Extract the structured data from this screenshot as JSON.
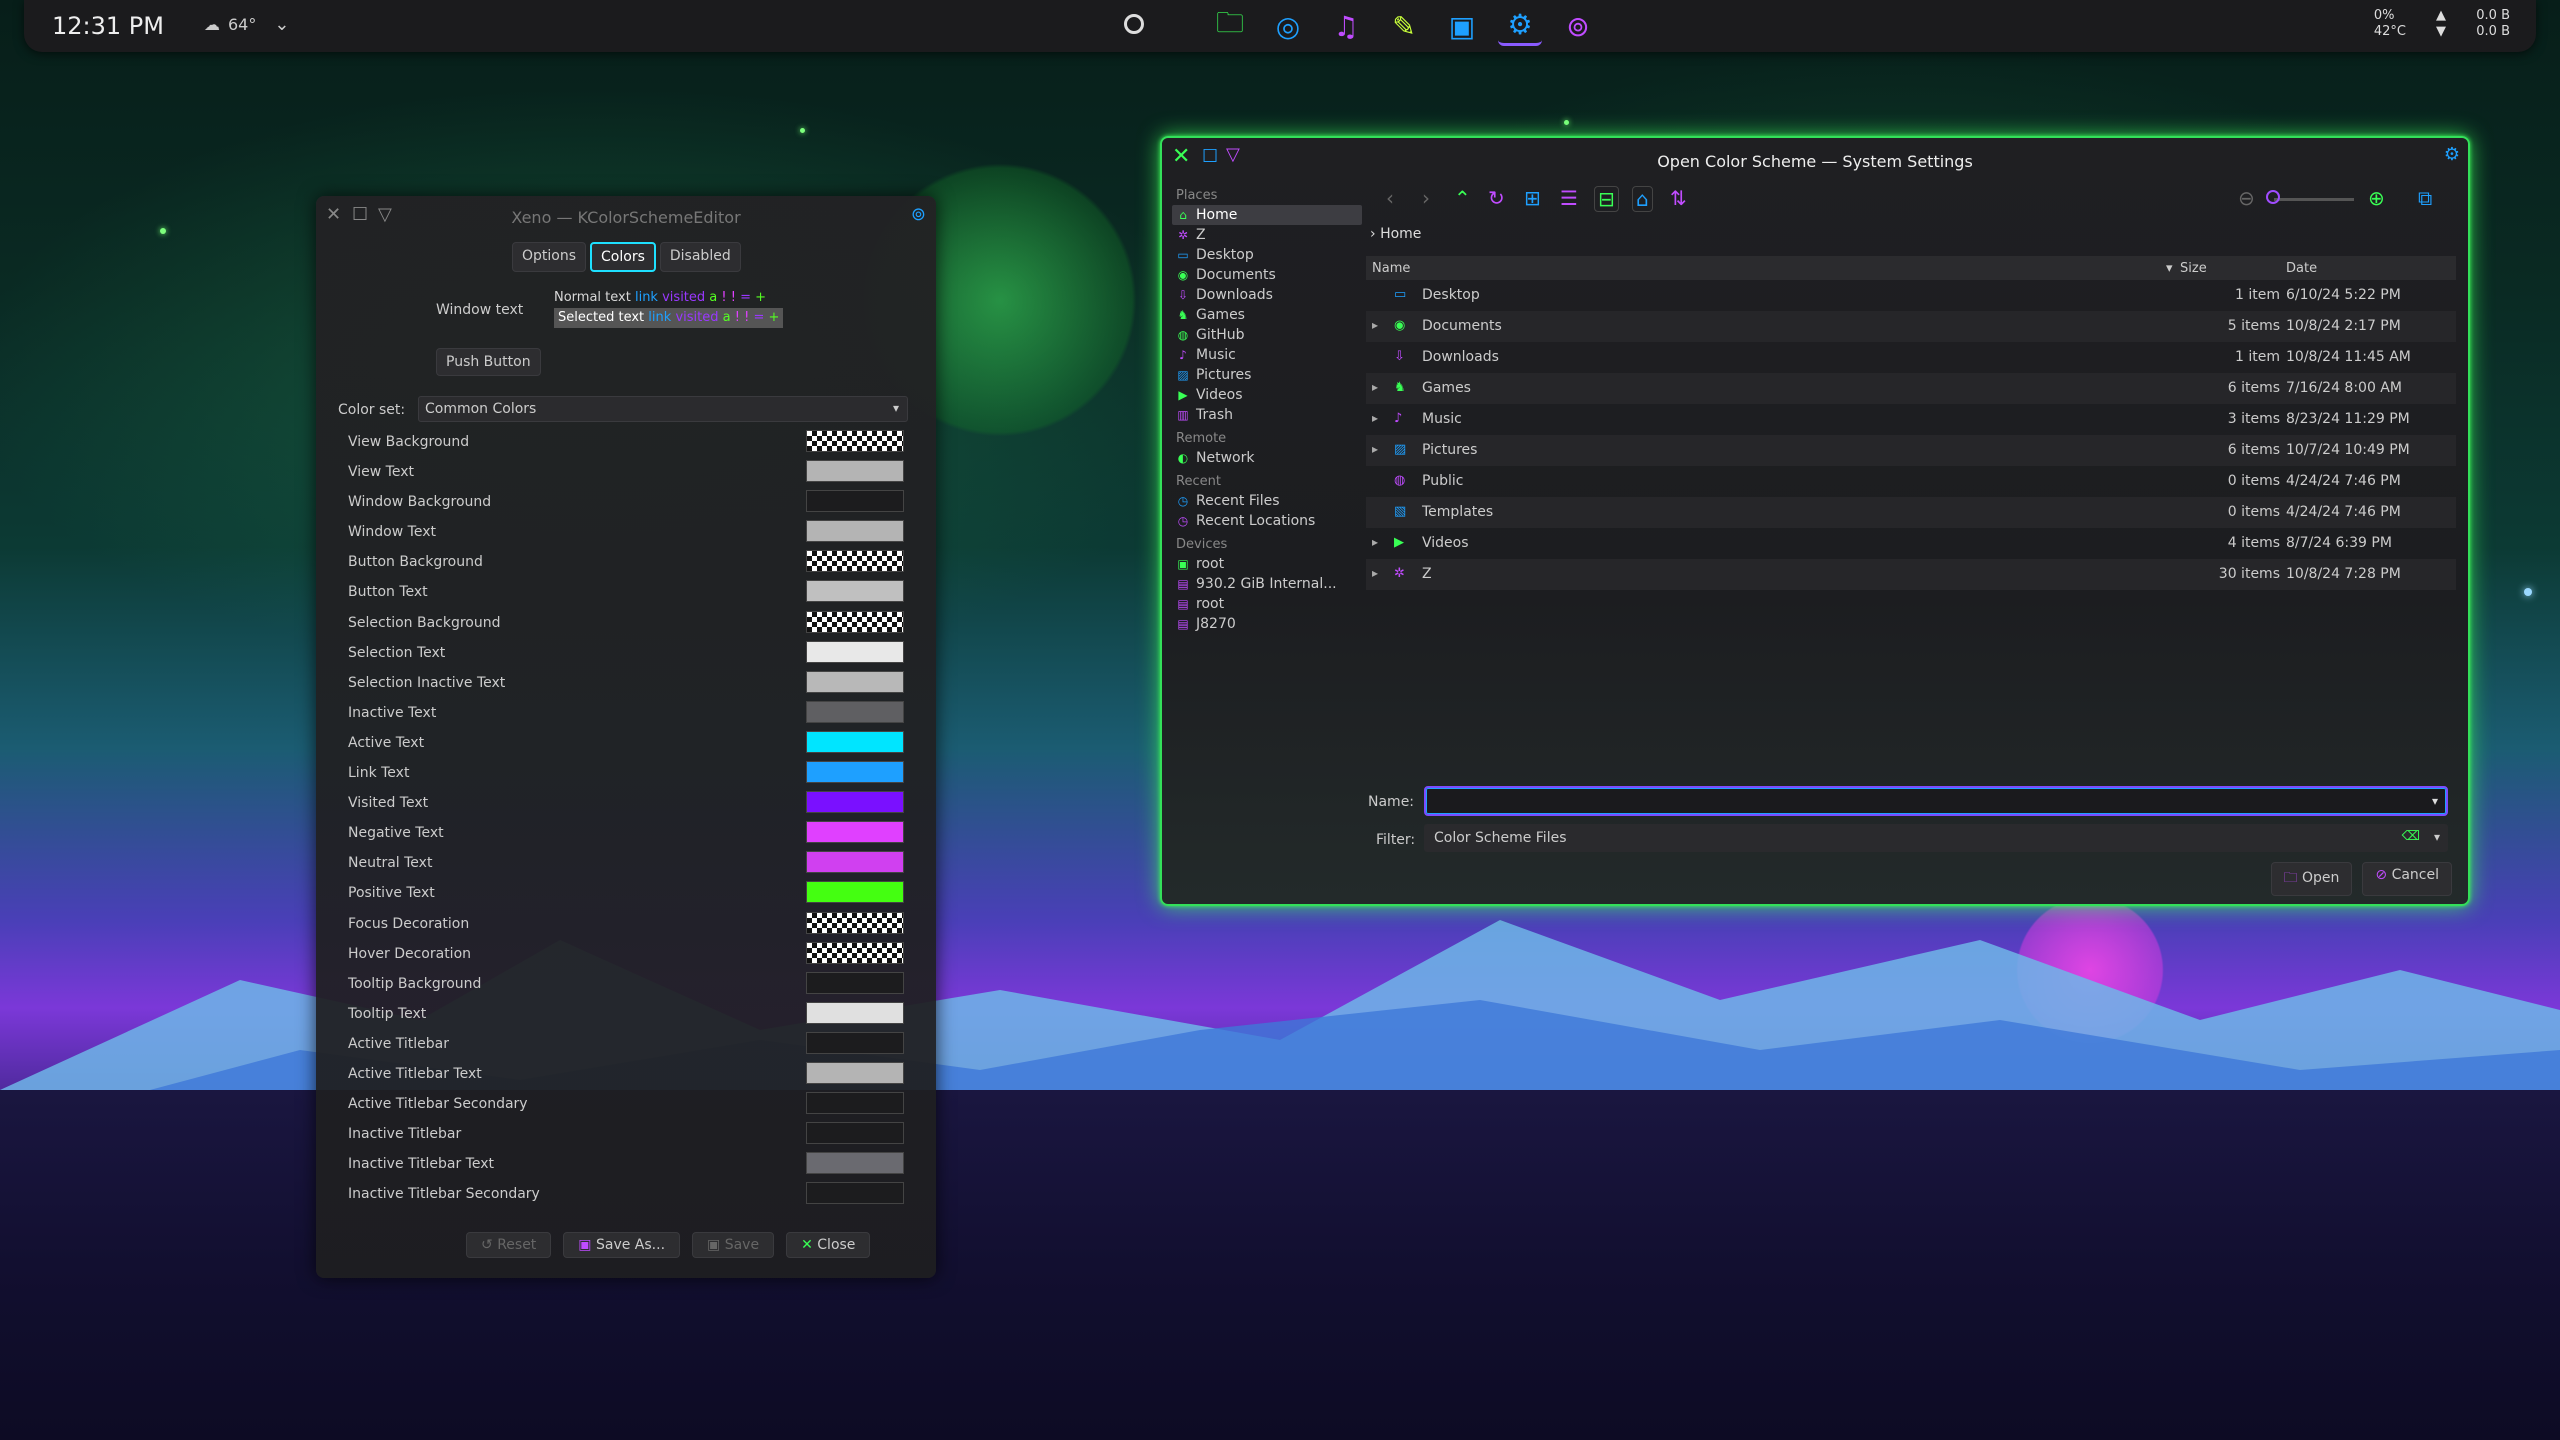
{
  "panel": {
    "clock": "12:31 PM",
    "weather_temp": "64°",
    "sys_cpu": "0%",
    "sys_temp": "42°C",
    "net_up": "0.0 B",
    "net_down": "0.0 B",
    "launcher": [
      {
        "name": "folder-icon",
        "glyph": "🗀",
        "color": "#39ff55"
      },
      {
        "name": "browser-icon",
        "glyph": "◎",
        "color": "#1ea0ff"
      },
      {
        "name": "music-icon",
        "glyph": "♫",
        "color": "#c04cff"
      },
      {
        "name": "notes-icon",
        "glyph": "✎",
        "color": "#c8ff3a"
      },
      {
        "name": "terminal-icon",
        "glyph": "▣",
        "color": "#1ea0ff"
      },
      {
        "name": "settings-icon",
        "glyph": "⚙",
        "color": "#1ea0ff",
        "active": true
      },
      {
        "name": "color-scheme-icon",
        "glyph": "⊚",
        "color": "#c04cff"
      }
    ]
  },
  "editor": {
    "title": "Xeno — KColorSchemeEditor",
    "tabs": [
      "Options",
      "Colors",
      "Disabled"
    ],
    "active_tab": "Colors",
    "preview_label": "Window text",
    "preview": {
      "normal": "Normal text",
      "selected": "Selected text",
      "link": "link",
      "visited": "visited",
      "a": "a",
      "bang": "!",
      "eq": "=",
      "plus": "+"
    },
    "push_button": "Push Button",
    "colorset_label": "Color set:",
    "colorset_value": "Common Colors",
    "colors": [
      {
        "name": "View Background",
        "color": "checker"
      },
      {
        "name": "View Text",
        "color": "#b4b4b4"
      },
      {
        "name": "Window Background",
        "color": "#1c1c1e"
      },
      {
        "name": "Window Text",
        "color": "#b4b4b4"
      },
      {
        "name": "Button Background",
        "color": "checker"
      },
      {
        "name": "Button Text",
        "color": "#c0c0c0"
      },
      {
        "name": "Selection Background",
        "color": "checker"
      },
      {
        "name": "Selection Text",
        "color": "#e8e8e8"
      },
      {
        "name": "Selection Inactive Text",
        "color": "#b8b8b8"
      },
      {
        "name": "Inactive Text",
        "color": "#5f5f62"
      },
      {
        "name": "Active Text",
        "color": "#00e5ff"
      },
      {
        "name": "Link Text",
        "color": "#1ea0ff"
      },
      {
        "name": "Visited Text",
        "color": "#7a10ff"
      },
      {
        "name": "Negative Text",
        "color": "#e040ff"
      },
      {
        "name": "Neutral Text",
        "color": "#d040f0"
      },
      {
        "name": "Positive Text",
        "color": "#44ff11"
      },
      {
        "name": "Focus Decoration",
        "color": "checker"
      },
      {
        "name": "Hover Decoration",
        "color": "checker"
      },
      {
        "name": "Tooltip Background",
        "color": "#1c1c1e"
      },
      {
        "name": "Tooltip Text",
        "color": "#e0e0e0"
      },
      {
        "name": "Active Titlebar",
        "color": "#1c1c1e"
      },
      {
        "name": "Active Titlebar Text",
        "color": "#b4b4b4"
      },
      {
        "name": "Active Titlebar Secondary",
        "color": "#1c1c1e"
      },
      {
        "name": "Inactive Titlebar",
        "color": "#1c1c1e"
      },
      {
        "name": "Inactive Titlebar Text",
        "color": "#6a6a70"
      },
      {
        "name": "Inactive Titlebar Secondary",
        "color": "#1c1c1e"
      }
    ],
    "footer": {
      "reset": "Reset",
      "save_as": "Save As...",
      "save": "Save",
      "close": "Close"
    }
  },
  "dialog": {
    "title": "Open Color Scheme — System Settings",
    "places": [
      {
        "type": "section",
        "label": "Places"
      },
      {
        "label": "Home",
        "glyph": "⌂",
        "color": "#39ff55",
        "selected": true
      },
      {
        "label": "Z",
        "glyph": "✲",
        "color": "#c04cff"
      },
      {
        "label": "Desktop",
        "glyph": "▭",
        "color": "#1ea0ff"
      },
      {
        "label": "Documents",
        "glyph": "◉",
        "color": "#39ff55"
      },
      {
        "label": "Downloads",
        "glyph": "⇩",
        "color": "#c04cff"
      },
      {
        "label": "Games",
        "glyph": "♞",
        "color": "#39ff55"
      },
      {
        "label": "GitHub",
        "glyph": "◍",
        "color": "#39ff55"
      },
      {
        "label": "Music",
        "glyph": "♪",
        "color": "#c04cff"
      },
      {
        "label": "Pictures",
        "glyph": "▨",
        "color": "#1ea0ff"
      },
      {
        "label": "Videos",
        "glyph": "▶",
        "color": "#39ff55"
      },
      {
        "label": "Trash",
        "glyph": "▥",
        "color": "#c04cff"
      },
      {
        "type": "section",
        "label": "Remote"
      },
      {
        "label": "Network",
        "glyph": "◐",
        "color": "#39ff55"
      },
      {
        "type": "section",
        "label": "Recent"
      },
      {
        "label": "Recent Files",
        "glyph": "◷",
        "color": "#1ea0ff"
      },
      {
        "label": "Recent Locations",
        "glyph": "◷",
        "color": "#c04cff"
      },
      {
        "type": "section",
        "label": "Devices"
      },
      {
        "label": "root",
        "glyph": "▣",
        "color": "#39ff55"
      },
      {
        "label": "930.2 GiB Internal...",
        "glyph": "▤",
        "color": "#c04cff"
      },
      {
        "label": "root",
        "glyph": "▤",
        "color": "#c04cff"
      },
      {
        "label": "J8270",
        "glyph": "▤",
        "color": "#c04cff"
      }
    ],
    "breadcrumb": "Home",
    "columns": {
      "name": "Name",
      "size": "Size",
      "date": "Date"
    },
    "files": [
      {
        "name": "Desktop",
        "size": "1 item",
        "date": "6/10/24 5:22 PM",
        "glyph": "▭",
        "color": "#1ea0ff",
        "expandable": false
      },
      {
        "name": "Documents",
        "size": "5 items",
        "date": "10/8/24 2:17 PM",
        "glyph": "◉",
        "color": "#39ff55",
        "expandable": true
      },
      {
        "name": "Downloads",
        "size": "1 item",
        "date": "10/8/24 11:45 AM",
        "glyph": "⇩",
        "color": "#c04cff",
        "expandable": false
      },
      {
        "name": "Games",
        "size": "6 items",
        "date": "7/16/24 8:00 AM",
        "glyph": "♞",
        "color": "#39ff55",
        "expandable": true
      },
      {
        "name": "Music",
        "size": "3 items",
        "date": "8/23/24 11:29 PM",
        "glyph": "♪",
        "color": "#c04cff",
        "expandable": true
      },
      {
        "name": "Pictures",
        "size": "6 items",
        "date": "10/7/24 10:49 PM",
        "glyph": "▨",
        "color": "#1ea0ff",
        "expandable": true
      },
      {
        "name": "Public",
        "size": "0 items",
        "date": "4/24/24 7:46 PM",
        "glyph": "◍",
        "color": "#c04cff",
        "expandable": false
      },
      {
        "name": "Templates",
        "size": "0 items",
        "date": "4/24/24 7:46 PM",
        "glyph": "▧",
        "color": "#1ea0ff",
        "expandable": false
      },
      {
        "name": "Videos",
        "size": "4 items",
        "date": "8/7/24 6:39 PM",
        "glyph": "▶",
        "color": "#39ff55",
        "expandable": true
      },
      {
        "name": "Z",
        "size": "30 items",
        "date": "10/8/24 7:28 PM",
        "glyph": "✲",
        "color": "#c04cff",
        "expandable": true
      }
    ],
    "name_label": "Name:",
    "name_value": "",
    "filter_label": "Filter:",
    "filter_value": "Color Scheme Files",
    "open_label": "Open",
    "cancel_label": "Cancel"
  }
}
